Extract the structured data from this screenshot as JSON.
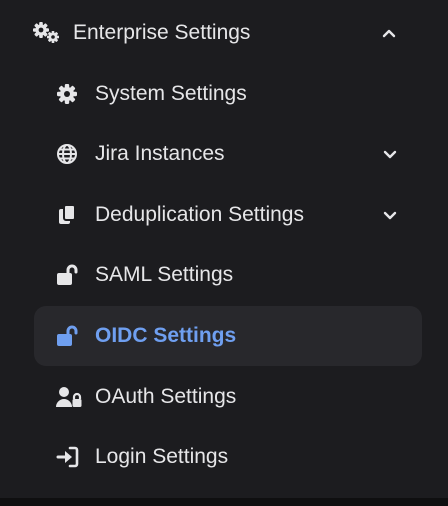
{
  "nav": {
    "parent": {
      "label": "Enterprise Settings",
      "icon": "gears-icon",
      "expanded": true
    },
    "items": [
      {
        "label": "System Settings",
        "icon": "gear-icon",
        "has_submenu": false,
        "active": false
      },
      {
        "label": "Jira Instances",
        "icon": "globe-icon",
        "has_submenu": true,
        "active": false
      },
      {
        "label": "Deduplication Settings",
        "icon": "copy-icon",
        "has_submenu": true,
        "active": false
      },
      {
        "label": "SAML Settings",
        "icon": "lock-open-icon",
        "has_submenu": false,
        "active": false
      },
      {
        "label": "OIDC Settings",
        "icon": "lock-open-icon",
        "has_submenu": false,
        "active": true
      },
      {
        "label": "OAuth Settings",
        "icon": "user-lock-icon",
        "has_submenu": false,
        "active": false
      },
      {
        "label": "Login Settings",
        "icon": "sign-in-icon",
        "has_submenu": false,
        "active": false
      }
    ]
  },
  "colors": {
    "background": "#1c1c1f",
    "text": "#e6e6e8",
    "active_text": "#6f9ff0",
    "active_background": "#28282c"
  }
}
